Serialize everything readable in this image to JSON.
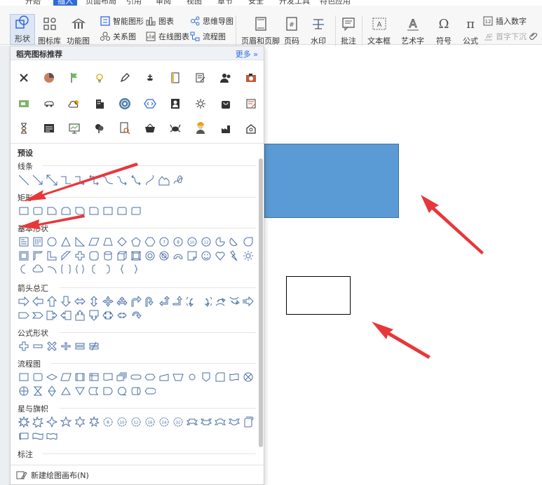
{
  "menu": {
    "items": [
      "开始",
      "插入",
      "页面布局",
      "引用",
      "审阅",
      "视图",
      "章节",
      "安全",
      "开发工具",
      "特色应用"
    ],
    "active": 1
  },
  "ribbon": {
    "shape": "形状",
    "icon_lib": "图标库",
    "func_chart": "功能图",
    "smart_shape": "智能图形",
    "chart": "图表",
    "mindmap": "思维导图",
    "relation": "关系图",
    "online_chart": "在线图表",
    "flowchart": "流程图",
    "header_footer": "页眉和页脚",
    "page_num": "页码",
    "watermark": "水印",
    "comment": "批注",
    "textbox": "文本框",
    "art_text": "艺术字",
    "symbol": "符号",
    "formula": "公式",
    "insert_num": "插入数字",
    "drop_cap": "首字下沉"
  },
  "panel": {
    "title": "稻壳图标推荐",
    "more": "更多",
    "preset": "预设",
    "cats": {
      "lines": "线条",
      "rect": "矩形",
      "basic": "基本形状",
      "arrows": "箭头总汇",
      "formula": "公式形状",
      "flow": "流程图",
      "stars": "星与旗帜",
      "callout": "标注"
    },
    "footer": "新建绘图画布(N)"
  },
  "colors": {
    "accent": "#2f6ad9",
    "blue_shape": "#5b9bd5",
    "arrow": "#e8373a"
  }
}
